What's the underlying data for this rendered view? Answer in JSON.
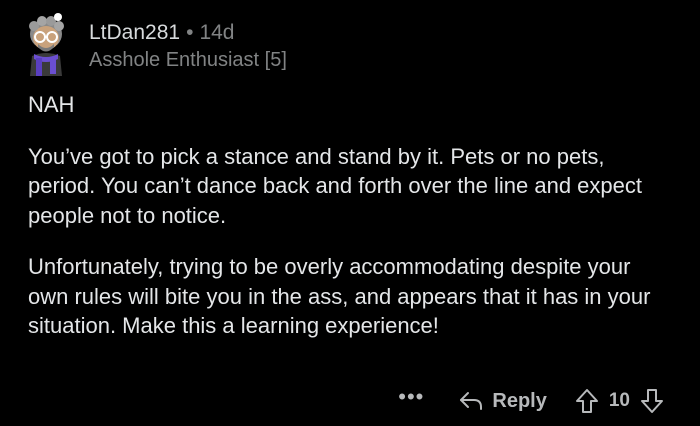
{
  "comment": {
    "author": "LtDan281",
    "separator": "•",
    "age": "14d",
    "flair": "Asshole Enthusiast [5]",
    "paragraphs": [
      "NAH",
      "You’ve got to pick a stance and stand by it. Pets or no pets, period. You can’t dance back and forth over the line and expect people not to notice.",
      "Unfortunately, trying to be overly accommodating despite your own rules will bite you in the ass, and appears that it has in your situation. Make this a learning experience!"
    ]
  },
  "actions": {
    "more_label": "•••",
    "reply_label": "Reply",
    "score": "10",
    "icons": [
      "more-icon",
      "reply-arrow-icon",
      "upvote-icon",
      "downvote-icon"
    ]
  },
  "colors": {
    "background": "#000000",
    "text": "#e4e6e8",
    "muted": "#818384"
  }
}
